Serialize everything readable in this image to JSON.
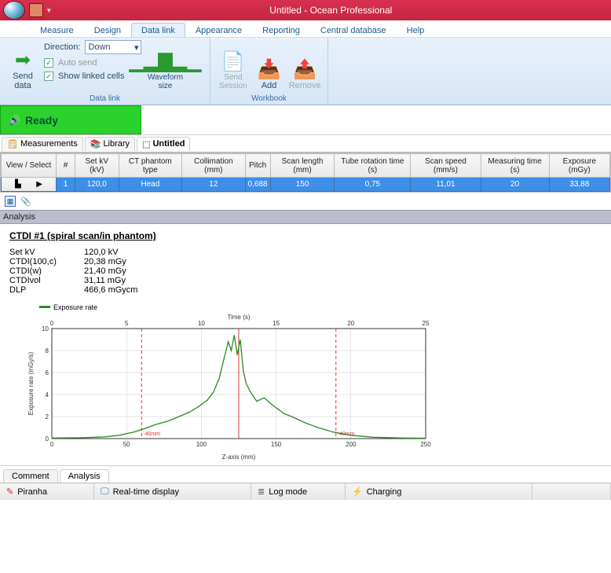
{
  "app": {
    "title": "Untitled - Ocean Professional"
  },
  "menu": {
    "tabs": [
      "Measure",
      "Design",
      "Data link",
      "Appearance",
      "Reporting",
      "Central database",
      "Help"
    ],
    "active_index": 2
  },
  "ribbon": {
    "send_data": "Send data",
    "direction_label": "Direction:",
    "direction_value": "Down",
    "auto_send": "Auto send",
    "show_linked": "Show linked cells",
    "group_datalink": "Data link",
    "waveform": "Waveform size",
    "send_session": "Send Session",
    "add": "Add",
    "remove": "Remove",
    "group_workbook": "Workbook"
  },
  "ready": "Ready",
  "doctabs": {
    "measurements": "Measurements",
    "library": "Library",
    "untitled": "Untitled"
  },
  "grid": {
    "headers": [
      "View / Select",
      "#",
      "Set kV (kV)",
      "CT phantom type",
      "Collimation (mm)",
      "Pitch",
      "Scan length (mm)",
      "Tube rotation time (s)",
      "Scan speed (mm/s)",
      "Measuring time (s)",
      "Exposure (mGy)"
    ],
    "row": {
      "num": "1",
      "setkv": "120,0",
      "phantom": "Head",
      "coll": "12",
      "pitch": "0,688",
      "scanlen": "150",
      "rot": "0,75",
      "speed": "11,01",
      "meas": "20",
      "exp": "33,88"
    }
  },
  "analysis_label": "Analysis",
  "ctdi": {
    "title": "CTDI #1 (spiral scan/in phantom)",
    "setkv_k": "Set kV",
    "setkv_v": "120,0 kV",
    "c100_k": "CTDI(100,c)",
    "c100_v": "20,38 mGy",
    "cw_k": "CTDI(w)",
    "cw_v": "21,40 mGy",
    "cvol_k": "CTDIvol",
    "cvol_v": "31,11 mGy",
    "dlp_k": "DLP",
    "dlp_v": "466,6 mGycm"
  },
  "chart_data": {
    "type": "line",
    "title": "",
    "legend": "Exposure rate",
    "time_label": "Time (s)",
    "x_label": "Z-axis (mm)",
    "y_label": "Exposure rate (mGy/s)",
    "x_ticks_top": [
      0,
      5,
      10,
      15,
      20,
      25
    ],
    "x_ticks_bottom": [
      0,
      50,
      100,
      150,
      200,
      250
    ],
    "y_ticks": [
      0,
      2,
      4,
      6,
      8,
      10
    ],
    "ylim": [
      0,
      10
    ],
    "xlim": [
      0,
      250
    ],
    "markers_red_mm": [
      60,
      125,
      190
    ],
    "marker_text": "-40mm",
    "series": [
      {
        "name": "Exposure rate",
        "x": [
          0,
          20,
          35,
          45,
          55,
          62,
          70,
          78,
          85,
          92,
          98,
          104,
          108,
          112,
          115,
          118,
          120,
          122,
          124,
          126,
          128,
          130,
          133,
          137,
          142,
          148,
          155,
          162,
          170,
          178,
          188,
          200,
          215,
          235,
          250
        ],
        "y": [
          0.05,
          0.08,
          0.15,
          0.3,
          0.6,
          0.9,
          1.3,
          1.6,
          2.0,
          2.4,
          2.9,
          3.5,
          4.2,
          5.5,
          7.2,
          8.8,
          8.0,
          9.4,
          7.6,
          9.0,
          6.2,
          5.0,
          4.2,
          3.4,
          3.7,
          3.0,
          2.3,
          1.9,
          1.4,
          1.0,
          0.6,
          0.3,
          0.12,
          0.05,
          0.03
        ]
      }
    ]
  },
  "bottom_tabs": {
    "comment": "Comment",
    "analysis": "Analysis"
  },
  "statusbar": {
    "piranha": "Piranha",
    "realtime": "Real-time display",
    "logmode": "Log mode",
    "charging": "Charging"
  }
}
